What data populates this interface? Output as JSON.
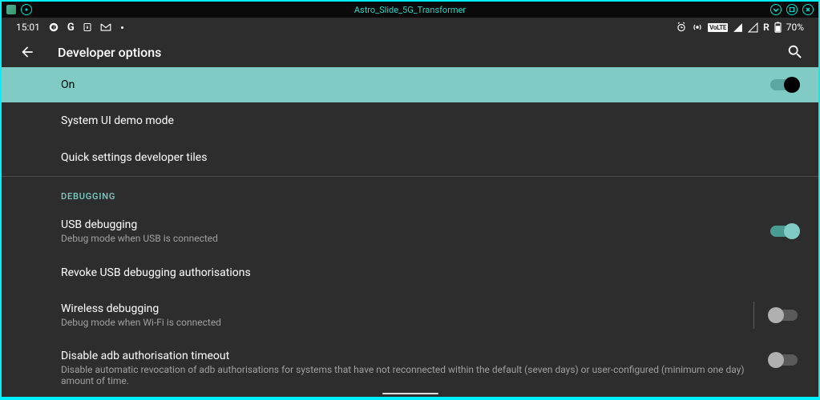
{
  "window": {
    "title": "Astro_Slide_5G_Transformer"
  },
  "status_bar": {
    "time": "15:01",
    "battery_text": "70%",
    "r_label": "R"
  },
  "app_bar": {
    "title": "Developer options"
  },
  "rows": {
    "on": {
      "label": "On"
    },
    "demo": {
      "label": "System UI demo mode"
    },
    "tiles": {
      "label": "Quick settings developer tiles"
    }
  },
  "section_debugging": "DEBUGGING",
  "debugging": {
    "usb": {
      "title": "USB debugging",
      "sub": "Debug mode when USB is connected"
    },
    "revoke": {
      "title": "Revoke USB debugging authorisations"
    },
    "wireless": {
      "title": "Wireless debugging",
      "sub": "Debug mode when Wi-Fi is connected"
    },
    "disable_timeout": {
      "title": "Disable adb authorisation timeout",
      "sub": "Disable automatic revocation of adb authorisations for systems that have not reconnected within the default (seven days) or user-configured (minimum one day) amount of time."
    }
  }
}
